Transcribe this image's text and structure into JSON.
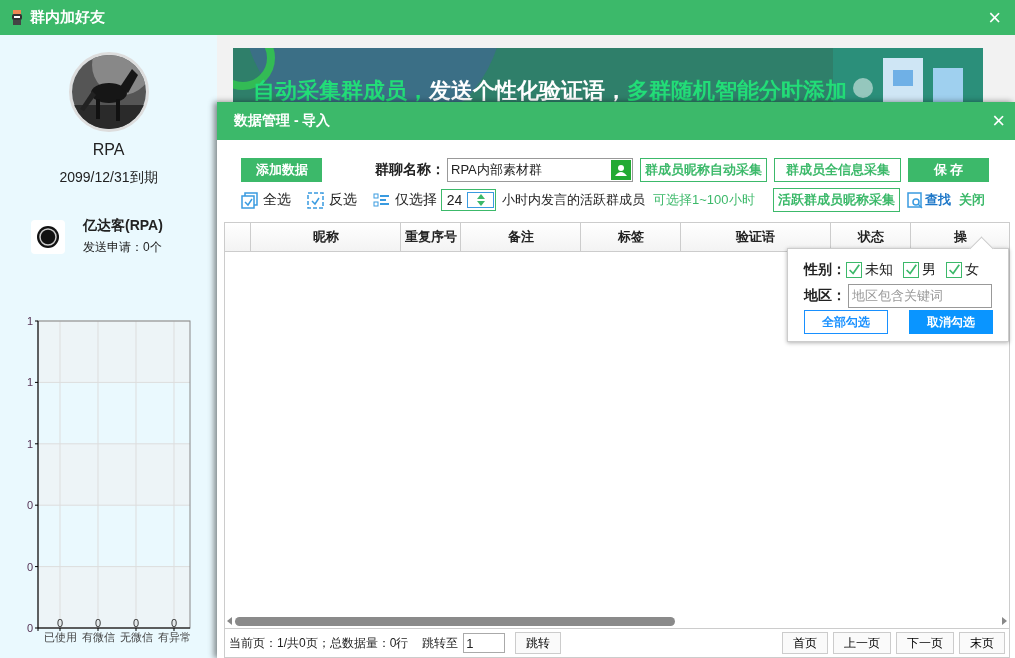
{
  "window": {
    "title": "群内加好友",
    "close": "×"
  },
  "profile": {
    "name": "RPA",
    "expiry": "2099/12/31到期"
  },
  "account": {
    "name": "亿达客(RPA)",
    "status": "发送申请：0个"
  },
  "stats": {
    "chart_data": {
      "type": "bar",
      "categories": [
        "已使用",
        "有微信",
        "无微信",
        "有异常"
      ],
      "values": [
        0,
        0,
        0,
        0
      ],
      "ylim": [
        0,
        1
      ],
      "yticks": [
        {
          "value": 0,
          "label": "0"
        },
        {
          "value": 0.2,
          "label": "0"
        },
        {
          "value": 0.4,
          "label": "0"
        },
        {
          "value": 0.6,
          "label": "1"
        },
        {
          "value": 0.8,
          "label": "1"
        },
        {
          "value": 1,
          "label": "1"
        }
      ],
      "data_labels": true,
      "grid": true
    }
  },
  "banner": {
    "segments": [
      {
        "text": "自动采集群成员，",
        "color": "#22dd77"
      },
      {
        "text": "发送个性化验证语，",
        "color": "#ffffff"
      },
      {
        "text": "多群随机智能分时添加",
        "color": "#22dd77"
      }
    ]
  },
  "dialog": {
    "title": "数据管理 - 导入",
    "close": "×",
    "add_button": "添加数据",
    "group_label": "群聊名称：",
    "group_value": "RPA内部素材群",
    "buttons": [
      {
        "label": "群成员昵称自动采集",
        "kind": "outline"
      },
      {
        "label": "群成员全信息采集",
        "kind": "outline"
      },
      {
        "label": "保 存",
        "kind": "filled"
      }
    ],
    "select_all": "全选",
    "invert": "反选",
    "only_select": "仅选择",
    "hours_value": "24",
    "hours_text": "小时内发言的活跃群成员",
    "hours_hint": "可选择1~100小时",
    "active_button": "活跃群成员昵称采集",
    "find": "查找",
    "close_link": "关闭",
    "table": {
      "columns": [
        "",
        "昵称",
        "重复序号",
        "备注",
        "标签",
        "验证语",
        "状态",
        "操"
      ]
    },
    "footer": {
      "info": "当前页：1/共0页；总数据量：0行",
      "jump_label": "跳转至",
      "jump_value": "1",
      "jump_button": "跳转",
      "pager": [
        "首页",
        "上一页",
        "下一页",
        "末页"
      ]
    }
  },
  "filter_popup": {
    "gender_label": "性别：",
    "genders": [
      {
        "label": "未知",
        "checked": true
      },
      {
        "label": "男",
        "checked": true
      },
      {
        "label": "女",
        "checked": true
      }
    ],
    "region_label": "地区：",
    "region_placeholder": "地区包含关键词",
    "select_all": "全部勾选",
    "deselect_all": "取消勾选"
  }
}
